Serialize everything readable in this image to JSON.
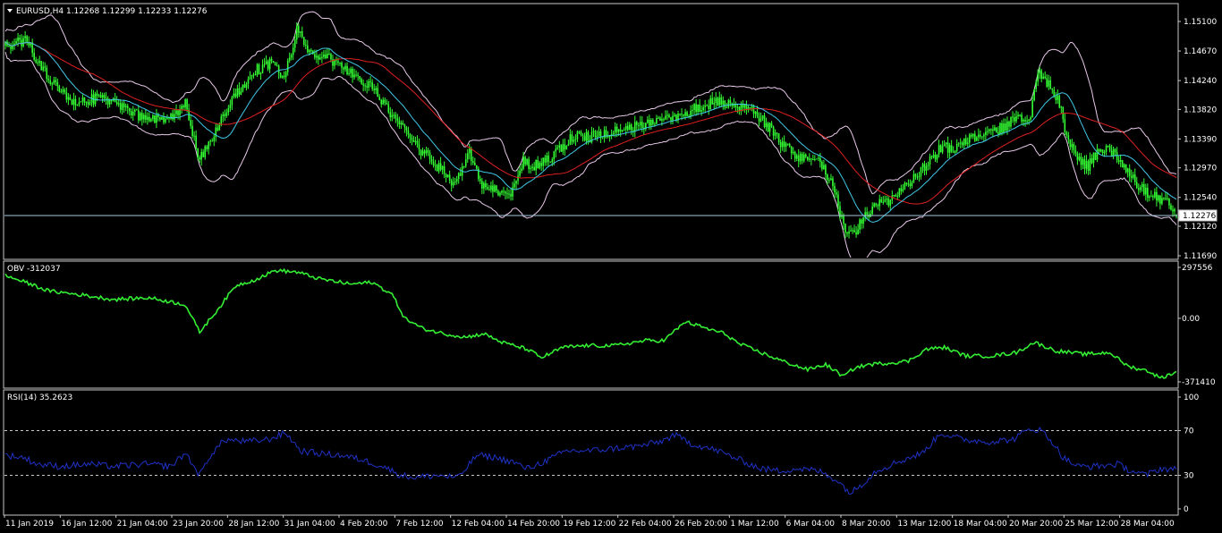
{
  "colors": {
    "background": "#000000",
    "frame": "#c8c8c8",
    "price_up": "#33ff33",
    "price_down": "#33ff33",
    "bollinger": "#e8c8e8",
    "ma_fast": "#40c8e8",
    "ma_slow": "#e02020",
    "obv": "#33ee33",
    "rsi": "#1f32c8",
    "level_line": "#a8c8dc",
    "price_tag_bg": "#ffffff",
    "text": "#ffffff"
  },
  "main_panel": {
    "title": "EURUSD,H4  1.12268 1.12299 1.12233 1.12276",
    "menu_icon": "triangle-down-icon",
    "current_price_tag": "1.12276"
  },
  "obv_panel": {
    "title": "OBV -312037"
  },
  "rsi_panel": {
    "title": "RSI(14) 35.2623"
  },
  "chart_data": [
    {
      "type": "candlestick",
      "title": "EURUSD,H4  1.12268 1.12299 1.12233 1.12276",
      "symbol": "EURUSD",
      "timeframe": "H4",
      "ohlc_last": {
        "open": 1.12268,
        "high": 1.12299,
        "low": 1.12233,
        "close": 1.12276
      },
      "ylim": [
        1.1169,
        1.1524
      ],
      "y_ticks": [
        "1.15100",
        "1.14670",
        "1.14240",
        "1.13820",
        "1.13390",
        "1.12970",
        "1.12540",
        "1.12120",
        "1.11690"
      ],
      "y_tick_values": [
        1.151,
        1.1467,
        1.1424,
        1.1382,
        1.1339,
        1.1297,
        1.1254,
        1.1212,
        1.1169
      ],
      "current_price": 1.12276,
      "x_ticks": [
        "11 Jan 2019",
        "16 Jan 12:00",
        "21 Jan 04:00",
        "23 Jan 20:00",
        "28 Jan 12:00",
        "31 Jan 04:00",
        "4 Feb 20:00",
        "7 Feb 12:00",
        "12 Feb 04:00",
        "14 Feb 20:00",
        "19 Feb 12:00",
        "22 Feb 04:00",
        "26 Feb 20:00",
        "1 Mar 12:00",
        "6 Mar 04:00",
        "8 Mar 20:00",
        "13 Mar 12:00",
        "18 Mar 04:00",
        "20 Mar 20:00",
        "25 Mar 12:00",
        "28 Mar 04:00"
      ],
      "close_anchors": [
        [
          0,
          1.1475
        ],
        [
          12,
          1.1482
        ],
        [
          20,
          1.1442
        ],
        [
          35,
          1.1395
        ],
        [
          55,
          1.1398
        ],
        [
          75,
          1.1372
        ],
        [
          90,
          1.1368
        ],
        [
          100,
          1.139
        ],
        [
          108,
          1.131
        ],
        [
          116,
          1.1342
        ],
        [
          125,
          1.1395
        ],
        [
          140,
          1.144
        ],
        [
          150,
          1.1452
        ],
        [
          155,
          1.1425
        ],
        [
          162,
          1.15
        ],
        [
          170,
          1.1462
        ],
        [
          180,
          1.1455
        ],
        [
          195,
          1.1432
        ],
        [
          205,
          1.141
        ],
        [
          215,
          1.137
        ],
        [
          225,
          1.134
        ],
        [
          232,
          1.132
        ],
        [
          240,
          1.13
        ],
        [
          250,
          1.1272
        ],
        [
          258,
          1.1318
        ],
        [
          266,
          1.1268
        ],
        [
          276,
          1.1262
        ],
        [
          282,
          1.1262
        ],
        [
          288,
          1.1305
        ],
        [
          296,
          1.13
        ],
        [
          306,
          1.1318
        ],
        [
          315,
          1.1342
        ],
        [
          326,
          1.1342
        ],
        [
          340,
          1.1355
        ],
        [
          354,
          1.1358
        ],
        [
          365,
          1.1364
        ],
        [
          378,
          1.1378
        ],
        [
          390,
          1.139
        ],
        [
          398,
          1.1392
        ],
        [
          405,
          1.139
        ],
        [
          416,
          1.1378
        ],
        [
          425,
          1.1355
        ],
        [
          432,
          1.133
        ],
        [
          440,
          1.1315
        ],
        [
          452,
          1.1308
        ],
        [
          460,
          1.127
        ],
        [
          468,
          1.1195
        ],
        [
          474,
          1.121
        ],
        [
          482,
          1.124
        ],
        [
          490,
          1.1248
        ],
        [
          498,
          1.1262
        ],
        [
          505,
          1.128
        ],
        [
          513,
          1.1305
        ],
        [
          520,
          1.1325
        ],
        [
          530,
          1.1328
        ],
        [
          540,
          1.1345
        ],
        [
          552,
          1.1353
        ],
        [
          562,
          1.1368
        ],
        [
          570,
          1.1375
        ],
        [
          574,
          1.1435
        ],
        [
          580,
          1.1418
        ],
        [
          586,
          1.1392
        ],
        [
          590,
          1.134
        ],
        [
          596,
          1.131
        ],
        [
          602,
          1.13
        ],
        [
          608,
          1.1325
        ],
        [
          615,
          1.132
        ],
        [
          622,
          1.13
        ],
        [
          630,
          1.127
        ],
        [
          638,
          1.1255
        ],
        [
          646,
          1.1248
        ],
        [
          651,
          1.1228
        ]
      ],
      "series": [
        {
          "name": "Bollinger Bands",
          "kind": "envelope"
        },
        {
          "name": "MA fast",
          "kind": "line"
        },
        {
          "name": "MA slow",
          "kind": "line"
        }
      ]
    },
    {
      "type": "line",
      "title": "OBV -312037",
      "y_ticks": [
        "297556",
        "0.00",
        "-371410"
      ],
      "y_tick_values": [
        297556,
        0,
        -371410
      ],
      "ylim": [
        -430000,
        320000
      ],
      "anchors": [
        [
          0,
          250000
        ],
        [
          14,
          200000
        ],
        [
          24,
          160000
        ],
        [
          40,
          140000
        ],
        [
          60,
          110000
        ],
        [
          80,
          120000
        ],
        [
          100,
          80000
        ],
        [
          108,
          -80000
        ],
        [
          118,
          50000
        ],
        [
          128,
          190000
        ],
        [
          140,
          230000
        ],
        [
          150,
          280000
        ],
        [
          162,
          270000
        ],
        [
          175,
          230000
        ],
        [
          192,
          200000
        ],
        [
          204,
          210000
        ],
        [
          215,
          140000
        ],
        [
          222,
          0
        ],
        [
          232,
          -60000
        ],
        [
          244,
          -90000
        ],
        [
          256,
          -110000
        ],
        [
          266,
          -90000
        ],
        [
          276,
          -140000
        ],
        [
          290,
          -180000
        ],
        [
          298,
          -230000
        ],
        [
          310,
          -170000
        ],
        [
          322,
          -160000
        ],
        [
          338,
          -160000
        ],
        [
          356,
          -130000
        ],
        [
          366,
          -130000
        ],
        [
          378,
          -20000
        ],
        [
          390,
          -60000
        ],
        [
          400,
          -90000
        ],
        [
          408,
          -150000
        ],
        [
          420,
          -200000
        ],
        [
          432,
          -250000
        ],
        [
          446,
          -300000
        ],
        [
          456,
          -270000
        ],
        [
          466,
          -340000
        ],
        [
          472,
          -290000
        ],
        [
          480,
          -270000
        ],
        [
          492,
          -260000
        ],
        [
          502,
          -250000
        ],
        [
          512,
          -180000
        ],
        [
          522,
          -170000
        ],
        [
          534,
          -220000
        ],
        [
          548,
          -220000
        ],
        [
          562,
          -200000
        ],
        [
          572,
          -140000
        ],
        [
          584,
          -190000
        ],
        [
          600,
          -210000
        ],
        [
          614,
          -200000
        ],
        [
          624,
          -280000
        ],
        [
          636,
          -310000
        ],
        [
          642,
          -350000
        ],
        [
          651,
          -312037
        ]
      ]
    },
    {
      "type": "line",
      "title": "RSI(14) 35.2623",
      "y_ticks": [
        "100",
        "70",
        "30",
        "0"
      ],
      "y_tick_values": [
        100,
        70,
        30,
        0
      ],
      "ylim": [
        0,
        100
      ],
      "levels": [
        70,
        30
      ],
      "anchors": [
        [
          0,
          48
        ],
        [
          10,
          46
        ],
        [
          18,
          40
        ],
        [
          30,
          38
        ],
        [
          46,
          40
        ],
        [
          60,
          38
        ],
        [
          78,
          40
        ],
        [
          92,
          38
        ],
        [
          100,
          50
        ],
        [
          108,
          30
        ],
        [
          114,
          48
        ],
        [
          122,
          62
        ],
        [
          134,
          60
        ],
        [
          146,
          62
        ],
        [
          156,
          68
        ],
        [
          164,
          52
        ],
        [
          172,
          50
        ],
        [
          186,
          48
        ],
        [
          198,
          44
        ],
        [
          210,
          38
        ],
        [
          220,
          30
        ],
        [
          228,
          28
        ],
        [
          240,
          30
        ],
        [
          252,
          28
        ],
        [
          262,
          48
        ],
        [
          272,
          46
        ],
        [
          282,
          42
        ],
        [
          290,
          36
        ],
        [
          302,
          44
        ],
        [
          312,
          52
        ],
        [
          326,
          52
        ],
        [
          338,
          54
        ],
        [
          352,
          56
        ],
        [
          364,
          60
        ],
        [
          372,
          66
        ],
        [
          382,
          58
        ],
        [
          396,
          52
        ],
        [
          408,
          44
        ],
        [
          420,
          36
        ],
        [
          430,
          34
        ],
        [
          440,
          36
        ],
        [
          452,
          34
        ],
        [
          462,
          26
        ],
        [
          470,
          14
        ],
        [
          476,
          22
        ],
        [
          484,
          34
        ],
        [
          496,
          42
        ],
        [
          510,
          50
        ],
        [
          520,
          68
        ],
        [
          532,
          62
        ],
        [
          546,
          60
        ],
        [
          560,
          62
        ],
        [
          570,
          72
        ],
        [
          576,
          70
        ],
        [
          582,
          60
        ],
        [
          588,
          46
        ],
        [
          596,
          38
        ],
        [
          606,
          38
        ],
        [
          618,
          40
        ],
        [
          626,
          34
        ],
        [
          634,
          30
        ],
        [
          642,
          36
        ],
        [
          651,
          35.2623
        ]
      ]
    }
  ]
}
